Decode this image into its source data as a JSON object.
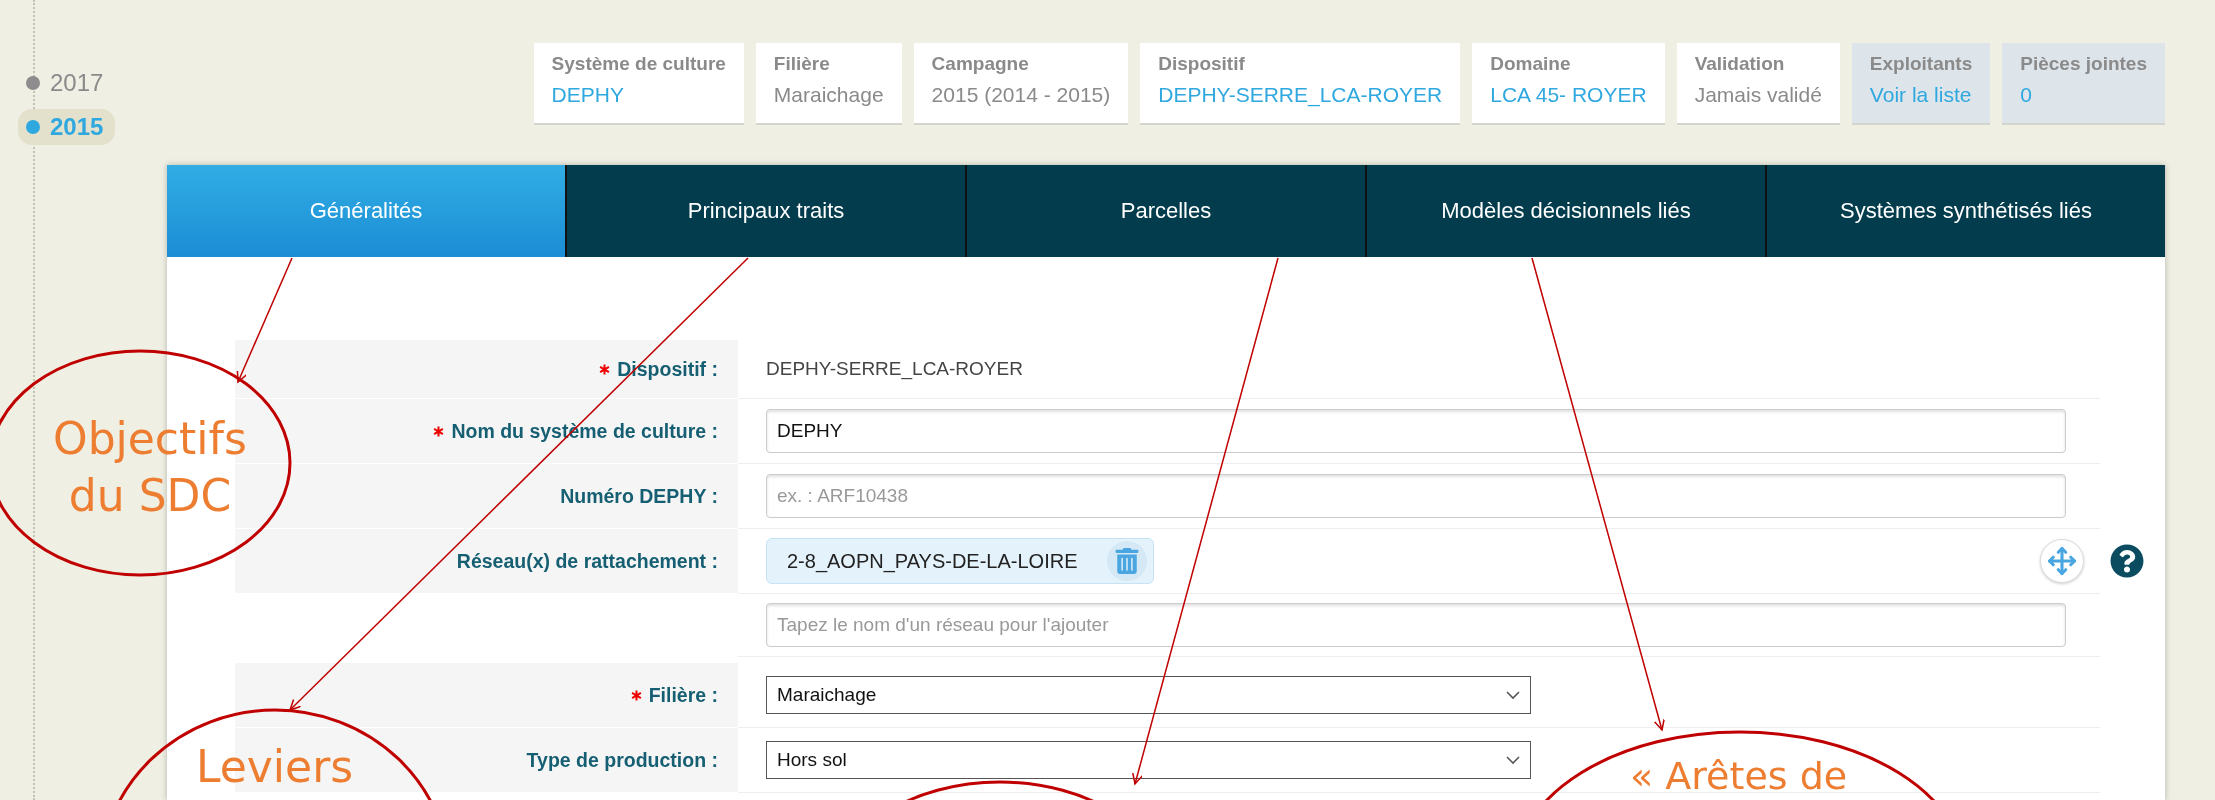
{
  "timeline": [
    {
      "year": "2017",
      "selected": false
    },
    {
      "year": "2015",
      "selected": true
    }
  ],
  "summary": [
    {
      "label": "Système de culture",
      "value": "DEPHY",
      "kind": "link",
      "shaded": false
    },
    {
      "label": "Filière",
      "value": "Maraichage",
      "kind": "text",
      "shaded": false
    },
    {
      "label": "Campagne",
      "value": "2015 (2014 - 2015)",
      "kind": "text",
      "shaded": false
    },
    {
      "label": "Dispositif",
      "value": "DEPHY-SERRE_LCA-ROYER",
      "kind": "link",
      "shaded": false
    },
    {
      "label": "Domaine",
      "value": "LCA 45- ROYER",
      "kind": "link",
      "shaded": false
    },
    {
      "label": "Validation",
      "value": "Jamais validé",
      "kind": "text",
      "shaded": false
    },
    {
      "label": "Exploitants",
      "value": "Voir la liste",
      "kind": "link",
      "shaded": true
    },
    {
      "label": "Pièces jointes",
      "value": "0",
      "kind": "link",
      "shaded": true
    }
  ],
  "tabs": [
    {
      "label": "Généralités",
      "selected": true
    },
    {
      "label": "Principaux traits",
      "selected": false
    },
    {
      "label": "Parcelles",
      "selected": false
    },
    {
      "label": "Modèles décisionnels liés",
      "selected": false
    },
    {
      "label": "Systèmes synthétisés liés",
      "selected": false
    }
  ],
  "form": {
    "sections": [
      {
        "rows": [
          {
            "label": "Dispositif :",
            "required": true,
            "kind": "static",
            "value": "DEPHY-SERRE_LCA-ROYER"
          },
          {
            "label": "Nom du système de culture :",
            "required": true,
            "kind": "input",
            "value": "DEPHY"
          },
          {
            "label": "Numéro DEPHY :",
            "required": false,
            "kind": "input",
            "placeholder": "ex. : ARF10438"
          },
          {
            "label": "Réseau(x) de rattachement :",
            "required": false,
            "kind": "tags",
            "tags": [
              "2-8_AOPN_PAYS-DE-LA-LOIRE"
            ],
            "placeholder": "Tapez le nom d'un réseau pour l'ajouter"
          }
        ]
      },
      {
        "rows": [
          {
            "label": "Filière :",
            "required": true,
            "kind": "select",
            "value": "Maraichage"
          },
          {
            "label": "Type de production :",
            "required": false,
            "kind": "select",
            "value": "Hors sol"
          }
        ]
      }
    ]
  },
  "annotations": [
    {
      "text": "Objectifs du SDC"
    },
    {
      "text": "Leviers"
    },
    {
      "text": "« Arêtes de"
    }
  ]
}
